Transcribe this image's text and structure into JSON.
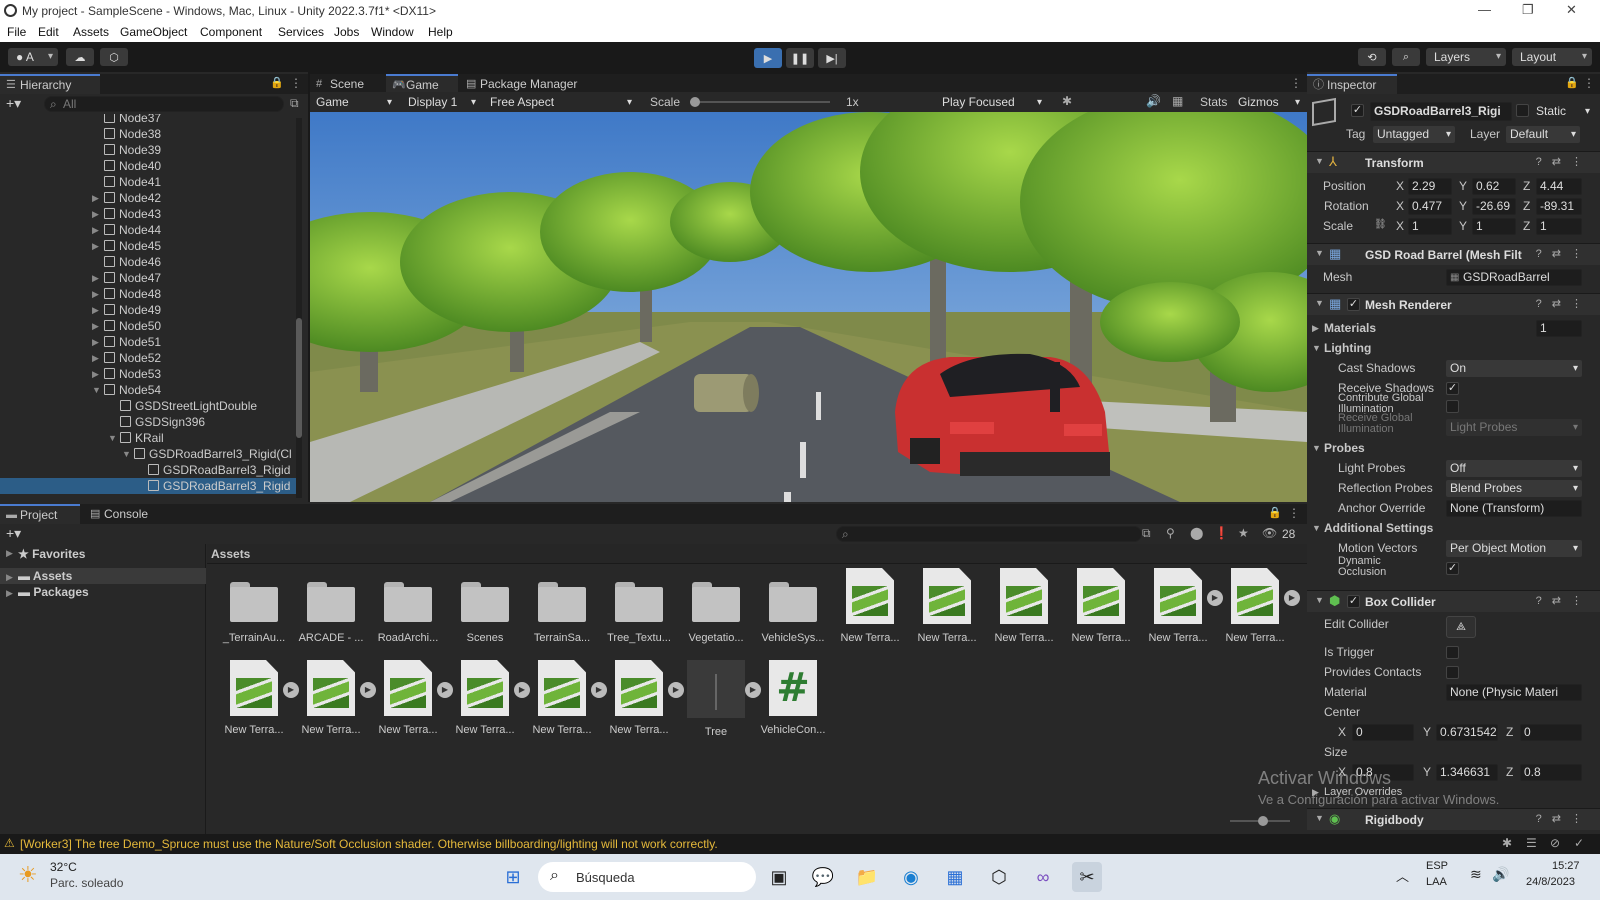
{
  "window": {
    "title": "My project - SampleScene - Windows, Mac, Linux - Unity 2022.3.7f1* <DX11>",
    "minimize": "—",
    "maximize": "❐",
    "close": "✕"
  },
  "menu": [
    "File",
    "Edit",
    "Assets",
    "GameObject",
    "Component",
    "Services",
    "Jobs",
    "Window",
    "Help"
  ],
  "toolbar": {
    "account": "A",
    "layers": "Layers",
    "layout": "Layout"
  },
  "hierarchy": {
    "tab": "Hierarchy",
    "search_placeholder": "All",
    "rows": [
      {
        "label": "Node37",
        "fold": ""
      },
      {
        "label": "Node38",
        "fold": ""
      },
      {
        "label": "Node39",
        "fold": ""
      },
      {
        "label": "Node40",
        "fold": ""
      },
      {
        "label": "Node41",
        "fold": ""
      },
      {
        "label": "Node42",
        "fold": "▶"
      },
      {
        "label": "Node43",
        "fold": "▶"
      },
      {
        "label": "Node44",
        "fold": "▶"
      },
      {
        "label": "Node45",
        "fold": "▶"
      },
      {
        "label": "Node46",
        "fold": ""
      },
      {
        "label": "Node47",
        "fold": "▶"
      },
      {
        "label": "Node48",
        "fold": "▶"
      },
      {
        "label": "Node49",
        "fold": "▶"
      },
      {
        "label": "Node50",
        "fold": "▶"
      },
      {
        "label": "Node51",
        "fold": "▶"
      },
      {
        "label": "Node52",
        "fold": "▶"
      },
      {
        "label": "Node53",
        "fold": "▶"
      },
      {
        "label": "Node54",
        "fold": "▼"
      },
      {
        "label": "GSDStreetLightDouble",
        "fold": ""
      },
      {
        "label": "GSDSign396",
        "fold": ""
      },
      {
        "label": "KRail",
        "fold": "▼"
      },
      {
        "label": "GSDRoadBarrel3_Rigid(Cl",
        "fold": "▼"
      },
      {
        "label": "GSDRoadBarrel3_Rigid",
        "fold": ""
      },
      {
        "label": "GSDRoadBarrel3_Rigid",
        "fold": ""
      }
    ]
  },
  "tabs": {
    "scene": "Scene",
    "game": "Game",
    "package": "Package Manager"
  },
  "gamebar": {
    "mode": "Game",
    "display": "Display 1",
    "aspect": "Free Aspect",
    "scale_label": "Scale",
    "scale_value": "1x",
    "play_focused": "Play Focused",
    "stats": "Stats",
    "gizmos": "Gizmos"
  },
  "inspector": {
    "tab": "Inspector",
    "object_name": "GSDRoadBarrel3_Rigi",
    "static": "Static",
    "tag_label": "Tag",
    "tag": "Untagged",
    "layer_label": "Layer",
    "layer": "Default",
    "transform": {
      "title": "Transform",
      "position": "Position",
      "rotation": "Rotation",
      "scale": "Scale",
      "px": "2.29",
      "py": "0.62",
      "pz": "4.44",
      "rx": "0.477",
      "ry": "-26.69",
      "rz": "-89.31",
      "sx": "1",
      "sy": "1",
      "sz": "1",
      "X": "X",
      "Y": "Y",
      "Z": "Z"
    },
    "mesh_filter": {
      "title": "GSD Road Barrel (Mesh Filt",
      "mesh_label": "Mesh",
      "mesh": "GSDRoadBarrel"
    },
    "mesh_renderer": {
      "title": "Mesh Renderer",
      "materials": "Materials",
      "materials_count": "1",
      "lighting": "Lighting",
      "cast_shadows": "Cast Shadows",
      "cast_shadows_val": "On",
      "receive_shadows": "Receive Shadows",
      "contribute_gi": "Contribute Global Illumination",
      "receive_gi": "Receive Global Illumination",
      "receive_gi_val": "Light Probes",
      "probes": "Probes",
      "light_probes": "Light Probes",
      "light_probes_val": "Off",
      "reflection_probes": "Reflection Probes",
      "reflection_probes_val": "Blend Probes",
      "anchor_override": "Anchor Override",
      "anchor_override_val": "None (Transform)",
      "additional": "Additional Settings",
      "motion_vectors": "Motion Vectors",
      "motion_vectors_val": "Per Object Motion",
      "dynamic_occlusion": "Dynamic Occlusion"
    },
    "box_collider": {
      "title": "Box Collider",
      "edit_collider": "Edit Collider",
      "is_trigger": "Is Trigger",
      "provides_contacts": "Provides Contacts",
      "material": "Material",
      "material_val": "None (Physic Materi",
      "center": "Center",
      "cx": "0",
      "cy": "0.6731542",
      "cz": "0",
      "size": "Size",
      "szx": "0.8",
      "szy": "1.346631",
      "szz": "0.8",
      "layer_overrides": "Layer Overrides"
    },
    "rigidbody": {
      "title": "Rigidbody"
    }
  },
  "project": {
    "tab_project": "Project",
    "tab_console": "Console",
    "favorites": "Favorites",
    "assets": "Assets",
    "packages": "Packages",
    "breadcrumb": "Assets",
    "hidden_count": "28",
    "row1": [
      {
        "label": "_TerrainAu...",
        "kind": "folder"
      },
      {
        "label": "ARCADE - ...",
        "kind": "folder"
      },
      {
        "label": "RoadArchi...",
        "kind": "folder"
      },
      {
        "label": "Scenes",
        "kind": "folder"
      },
      {
        "label": "TerrainSa...",
        "kind": "folder"
      },
      {
        "label": "Tree_Textu...",
        "kind": "folder"
      },
      {
        "label": "Vegetatio...",
        "kind": "folder"
      },
      {
        "label": "VehicleSys...",
        "kind": "folder"
      },
      {
        "label": "New Terra...",
        "kind": "terrain"
      },
      {
        "label": "New Terra...",
        "kind": "terrain"
      },
      {
        "label": "New Terra...",
        "kind": "terrain"
      },
      {
        "label": "New Terra...",
        "kind": "terrain"
      },
      {
        "label": "New Terra...",
        "kind": "terrain"
      },
      {
        "label": "New Terra...",
        "kind": "terrain"
      }
    ],
    "row2": [
      {
        "label": "New Terra...",
        "kind": "terrain"
      },
      {
        "label": "New Terra...",
        "kind": "terrain"
      },
      {
        "label": "New Terra...",
        "kind": "terrain"
      },
      {
        "label": "New Terra...",
        "kind": "terrain"
      },
      {
        "label": "New Terra...",
        "kind": "terrain"
      },
      {
        "label": "New Terra...",
        "kind": "terrain"
      },
      {
        "label": "Tree",
        "kind": "tree"
      },
      {
        "label": "VehicleCon...",
        "kind": "script"
      }
    ]
  },
  "watermark": {
    "line1": "Activar Windows",
    "line2": "Ve a Configuración para activar Windows."
  },
  "status": {
    "message": "[Worker3] The tree Demo_Spruce must use the Nature/Soft Occlusion shader. Otherwise billboarding/lighting will not work correctly."
  },
  "taskbar": {
    "temp": "32°C",
    "weather": "Parc. soleado",
    "search": "Búsqueda",
    "lang1": "ESP",
    "lang2": "LAA",
    "time": "15:27",
    "date": "24/8/2023"
  },
  "colors": {
    "accent": "#4a7bd0",
    "selection": "#2c5d87",
    "play_active": "#3a6fb0"
  }
}
